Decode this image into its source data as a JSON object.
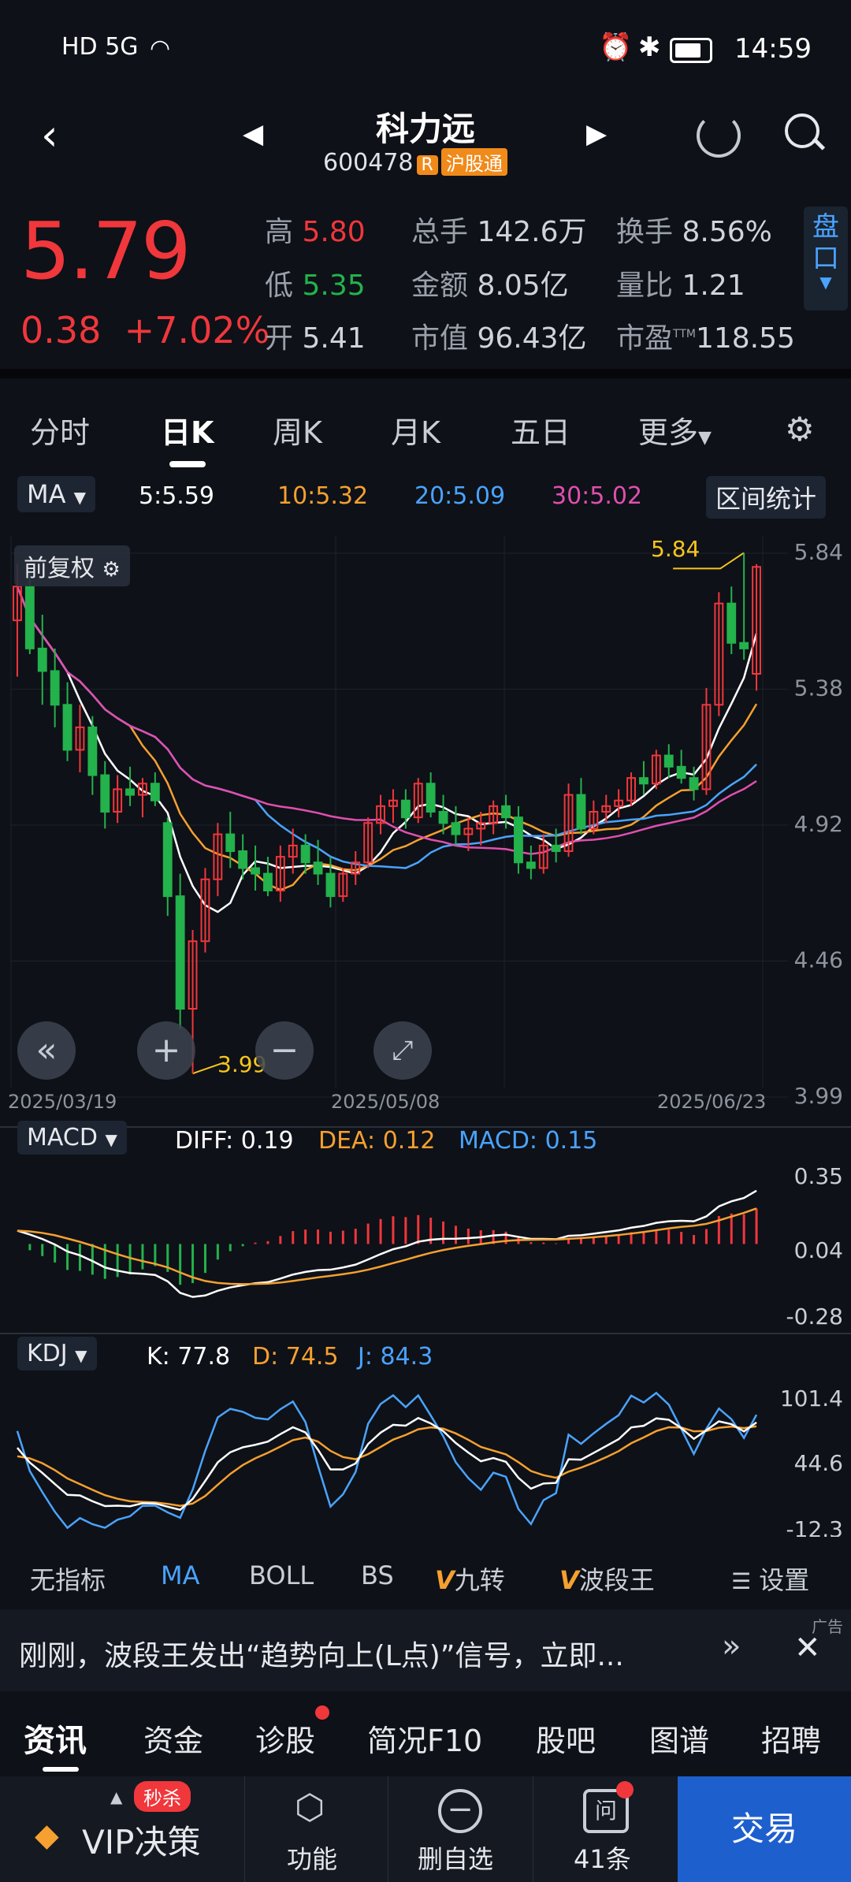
{
  "status_bar": {
    "left": "HD 5G",
    "time": "14:59"
  },
  "stock": {
    "name": "科力远",
    "code": "600478",
    "r_tag": "R",
    "hk_tag": "沪股通"
  },
  "quote": {
    "price": "5.79",
    "change": "0.38",
    "change_pct": "+7.02%",
    "high_label": "高",
    "high": "5.80",
    "low_label": "低",
    "low": "5.35",
    "open_label": "开",
    "open": "5.41",
    "vol_label": "总手",
    "vol": "142.6万",
    "amt_label": "金额",
    "amt": "8.05亿",
    "mcap_label": "市值",
    "mcap": "96.43亿",
    "turn_label": "换手",
    "turn": "8.56%",
    "ratio_label": "量比",
    "ratio": "1.21",
    "pe_label": "市盈",
    "pe_sup": "TTM",
    "pe": "118.55",
    "pankou": "盘口"
  },
  "tabs": [
    "分时",
    "日K",
    "周K",
    "月K",
    "五日",
    "更多"
  ],
  "ma": {
    "label": "MA",
    "ma5": "5:5.59",
    "ma10": "10:5.32",
    "ma20": "20:5.09",
    "ma30": "30:5.02",
    "range_btn": "区间统计"
  },
  "chart": {
    "adjust": "前复权",
    "high_mark": "5.84",
    "low_mark": "3.99"
  },
  "chart_data": {
    "type": "candlestick",
    "price_axis": [
      "5.84",
      "5.38",
      "4.92",
      "4.46",
      "3.99"
    ],
    "dates": [
      "2025/03/19",
      "2025/05/08",
      "2025/06/23"
    ],
    "ohlc": [
      [
        5.6,
        5.8,
        5.4,
        5.72
      ],
      [
        5.72,
        5.78,
        5.48,
        5.5
      ],
      [
        5.5,
        5.62,
        5.3,
        5.42
      ],
      [
        5.42,
        5.5,
        5.22,
        5.3
      ],
      [
        5.3,
        5.38,
        5.1,
        5.14
      ],
      [
        5.14,
        5.3,
        5.06,
        5.22
      ],
      [
        5.22,
        5.26,
        4.98,
        5.05
      ],
      [
        5.05,
        5.1,
        4.86,
        4.92
      ],
      [
        4.92,
        5.05,
        4.88,
        5.0
      ],
      [
        5.0,
        5.08,
        4.94,
        4.98
      ],
      [
        4.98,
        5.04,
        4.9,
        5.02
      ],
      [
        5.02,
        5.06,
        4.94,
        4.96
      ],
      [
        4.88,
        4.9,
        4.55,
        4.62
      ],
      [
        4.62,
        4.7,
        4.15,
        4.22
      ],
      [
        4.22,
        4.5,
        3.99,
        4.46
      ],
      [
        4.46,
        4.72,
        4.42,
        4.68
      ],
      [
        4.68,
        4.88,
        4.62,
        4.84
      ],
      [
        4.84,
        4.92,
        4.72,
        4.78
      ],
      [
        4.78,
        4.84,
        4.68,
        4.72
      ],
      [
        4.72,
        4.8,
        4.64,
        4.7
      ],
      [
        4.7,
        4.76,
        4.62,
        4.64
      ],
      [
        4.64,
        4.8,
        4.6,
        4.76
      ],
      [
        4.76,
        4.86,
        4.7,
        4.8
      ],
      [
        4.8,
        4.84,
        4.7,
        4.74
      ],
      [
        4.74,
        4.82,
        4.66,
        4.7
      ],
      [
        4.7,
        4.76,
        4.58,
        4.62
      ],
      [
        4.62,
        4.72,
        4.6,
        4.7
      ],
      [
        4.7,
        4.78,
        4.66,
        4.74
      ],
      [
        4.74,
        4.9,
        4.72,
        4.88
      ],
      [
        4.88,
        4.98,
        4.84,
        4.94
      ],
      [
        4.94,
        5.0,
        4.88,
        4.96
      ],
      [
        4.96,
        5.0,
        4.86,
        4.9
      ],
      [
        4.9,
        5.04,
        4.88,
        5.02
      ],
      [
        5.02,
        5.06,
        4.9,
        4.92
      ],
      [
        4.92,
        4.98,
        4.84,
        4.88
      ],
      [
        4.88,
        4.94,
        4.8,
        4.84
      ],
      [
        4.84,
        4.9,
        4.78,
        4.86
      ],
      [
        4.86,
        4.92,
        4.8,
        4.88
      ],
      [
        4.88,
        4.96,
        4.84,
        4.94
      ],
      [
        4.94,
        4.98,
        4.86,
        4.9
      ],
      [
        4.9,
        4.94,
        4.7,
        4.74
      ],
      [
        4.74,
        4.8,
        4.68,
        4.72
      ],
      [
        4.72,
        4.84,
        4.7,
        4.8
      ],
      [
        4.8,
        4.86,
        4.74,
        4.78
      ],
      [
        4.78,
        5.02,
        4.76,
        4.98
      ],
      [
        4.98,
        5.04,
        4.84,
        4.86
      ],
      [
        4.86,
        4.96,
        4.84,
        4.92
      ],
      [
        4.92,
        4.98,
        4.88,
        4.94
      ],
      [
        4.94,
        5.0,
        4.9,
        4.96
      ],
      [
        4.96,
        5.06,
        4.94,
        5.04
      ],
      [
        5.04,
        5.1,
        4.98,
        5.02
      ],
      [
        5.02,
        5.14,
        5.0,
        5.12
      ],
      [
        5.12,
        5.16,
        5.04,
        5.08
      ],
      [
        5.08,
        5.14,
        5.02,
        5.04
      ],
      [
        5.04,
        5.08,
        4.96,
        5.0
      ],
      [
        5.0,
        5.36,
        4.98,
        5.3
      ],
      [
        5.3,
        5.7,
        5.26,
        5.66
      ],
      [
        5.66,
        5.72,
        5.48,
        5.52
      ],
      [
        5.52,
        5.84,
        5.46,
        5.5
      ],
      [
        5.41,
        5.8,
        5.35,
        5.79
      ]
    ],
    "macd": {
      "label": "MACD",
      "diff": "DIFF: 0.19",
      "dea": "DEA: 0.12",
      "macd": "MACD: 0.15",
      "axis": [
        "0.35",
        "0.04",
        "-0.28"
      ]
    },
    "kdj": {
      "label": "KDJ",
      "k": "K: 77.8",
      "d": "D: 74.5",
      "j": "J: 84.3",
      "axis": [
        "101.4",
        "44.6",
        "-12.3"
      ]
    }
  },
  "indicators": [
    "无指标",
    "MA",
    "BOLL",
    "BS",
    "九转",
    "波段王",
    "设置"
  ],
  "banner": {
    "text": "刚刚，波段王发出“趋势向上(L点)”信号，立即...",
    "ad": "广告"
  },
  "info_tabs": [
    "资讯",
    "资金",
    "诊股",
    "简况F10",
    "股吧",
    "图谱",
    "招聘"
  ],
  "bottom": {
    "vip": "VIP决策",
    "miaosha": "秒杀",
    "func": "功能",
    "del": "删自选",
    "q": "41条",
    "q_icon": "问",
    "trade": "交易"
  },
  "colors": {
    "up": "#f0373c",
    "down": "#23b24c",
    "ma5": "#ffffff",
    "ma10": "#f5a030",
    "ma20": "#4aa3ff",
    "ma30": "#e04fb0"
  }
}
